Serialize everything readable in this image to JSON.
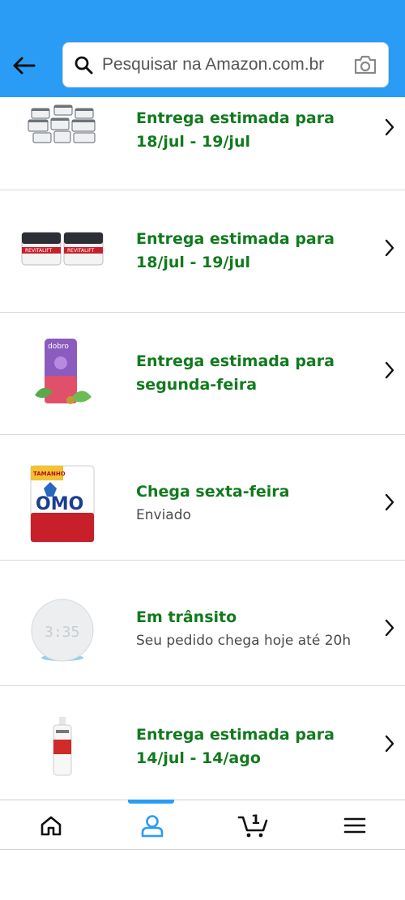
{
  "header": {
    "search_placeholder": "Pesquisar na Amazon.com.br"
  },
  "orders": [
    {
      "image": "food-containers-set",
      "title": "Entrega estimada para 18/jul - 19/jul",
      "subtitle": ""
    },
    {
      "image": "revitalift-cream-pair",
      "title": "Entrega estimada para 18/jul - 19/jul",
      "subtitle": ""
    },
    {
      "image": "dobro-supplement-can",
      "title": "Entrega estimada para segunda-feira",
      "subtitle": ""
    },
    {
      "image": "omo-detergent-bag",
      "title": "Chega sexta-feira",
      "subtitle": "Enviado"
    },
    {
      "image": "echo-dot-speaker",
      "title": "Em trânsito",
      "subtitle": "Seu pedido chega hoje até 20h"
    },
    {
      "image": "shampoo-bottle",
      "title": "Entrega estimada para 14/jul - 14/ago",
      "subtitle": ""
    }
  ],
  "bottom_nav": {
    "items": [
      "home",
      "account",
      "cart",
      "menu"
    ],
    "active": "account",
    "cart_count": "1"
  },
  "colors": {
    "header": "#2a9cf5",
    "status_green": "#117a1e",
    "active_nav": "#2a9cf5"
  }
}
